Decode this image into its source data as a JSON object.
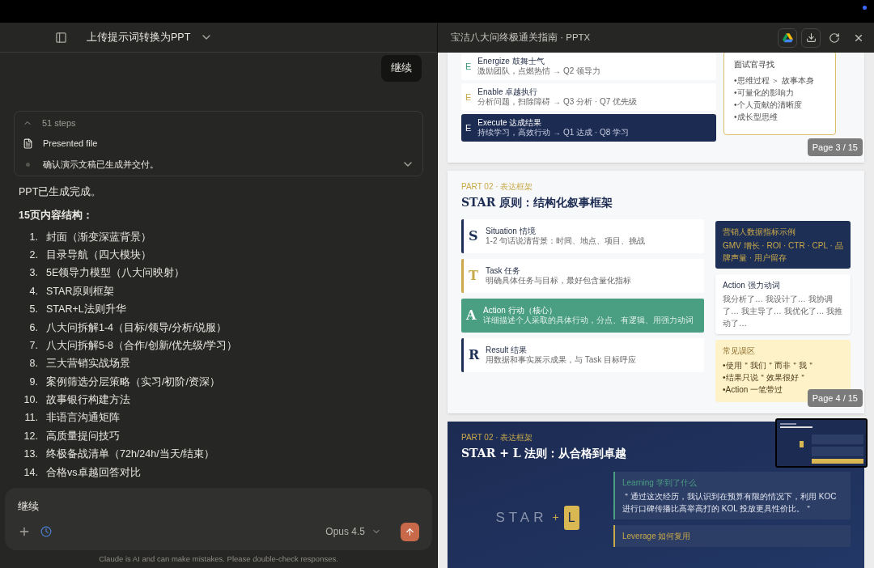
{
  "chat": {
    "title": "上传提示词转换为PPT",
    "user_message": "继续",
    "steps": {
      "count": "51 steps",
      "expanded": true,
      "items": [
        {
          "kind": "file",
          "label": "Presented file"
        },
        {
          "kind": "dot",
          "label": "确认演示文稿已生成并交付。"
        }
      ]
    },
    "reply": {
      "intro": "PPT已生成完成。",
      "heading": "15页内容结构：",
      "list": [
        {
          "num": "1.",
          "text": "封面（渐变深蓝背景）"
        },
        {
          "num": "2.",
          "text": "目录导航（四大模块）"
        },
        {
          "num": "3.",
          "text": "5E领导力模型（八大问映射）"
        },
        {
          "num": "4.",
          "text": "STAR原则框架"
        },
        {
          "num": "5.",
          "text": "STAR+L法则升华"
        },
        {
          "num": "6.",
          "text": "八大问拆解1-4（目标/领导/分析/说服）"
        },
        {
          "num": "7.",
          "text": "八大问拆解5-8（合作/创新/优先级/学习）"
        },
        {
          "num": "8.",
          "text": "三大营销实战场景"
        },
        {
          "num": "9.",
          "text": "案例筛选分层策略（实习/初阶/资深）"
        },
        {
          "num": "10.",
          "text": "故事银行构建方法"
        },
        {
          "num": "11.",
          "text": "非语言沟通矩阵"
        },
        {
          "num": "12.",
          "text": "高质量提问技巧"
        },
        {
          "num": "13.",
          "text": "终极备战清单（72h/24h/当天/结束）"
        },
        {
          "num": "14.",
          "text": "合格vs卓越回答对比"
        }
      ]
    },
    "input": {
      "value": "继续",
      "model": "Opus 4.5",
      "timer_active": true
    },
    "disclaimer": "Claude is AI and can make mistakes. Please double-check responses."
  },
  "preview": {
    "title": "宝洁八大问终极通关指南 · PPTX",
    "slides": [
      {
        "kind": "e_model",
        "page": "Page 3 / 15",
        "items": [
          {
            "letter": "E",
            "title": "Energize  鼓舞士气",
            "desc": "激励团队，点燃热情 → Q2 领导力",
            "color": "#3a9a7a",
            "highlighted": false
          },
          {
            "letter": "E",
            "title": "Enable  卓越执行",
            "desc": "分析问题，扫除障碍 → Q3 分析 · Q7 优先级",
            "color": "#c9a94a",
            "highlighted": false
          },
          {
            "letter": "E",
            "title": "Execute  达成结果",
            "desc": "持续学习，高效行动 → Q1 达成 · Q8 学习",
            "color": "#ffffff",
            "highlighted": true
          }
        ],
        "side": {
          "heading": "面试官寻找",
          "bullets": [
            "•思维过程 ＞ 故事本身",
            "•可量化的影响力",
            "•个人贡献的清晰度",
            "•成长型思维"
          ]
        }
      },
      {
        "kind": "star",
        "page": "Page 4 / 15",
        "part": "PART 02 · 表达框架",
        "title": "STAR 原则：结构化叙事框架",
        "items": [
          {
            "letter": "S",
            "title": "Situation  情境",
            "desc": "1-2 句话说清背景：时间、地点、项目、挑战",
            "color": "#1e2f55",
            "filled": false
          },
          {
            "letter": "T",
            "title": "Task  任务",
            "desc": "明确具体任务与目标，最好包含量化指标",
            "color": "#c9a94a",
            "filled": false
          },
          {
            "letter": "A",
            "title": "Action  行动（核心）",
            "desc": "详细描述个人采取的具体行动，分点、有逻辑、用强力动词",
            "color": "#4a9e82",
            "filled": true
          },
          {
            "letter": "R",
            "title": "Result  结果",
            "desc": "用数据和事实展示成果，与 Task 目标呼应",
            "color": "#1e2f55",
            "filled": false
          }
        ],
        "cards": [
          {
            "kind": "dark",
            "heading": "营销人数据指标示例",
            "body": "GMV 增长 · ROI · CTR · CPL · 品牌声量 · 用户留存"
          },
          {
            "kind": "white",
            "heading": "Action 强力动词",
            "body": "我分析了… 我设计了… 我协调了… 我主导了… 我优化了… 我推动了…"
          },
          {
            "kind": "yellow",
            "heading": "常见误区",
            "bullets": [
              "•使用＂我们＂而非＂我＂",
              "•结果只说＂效果很好＂",
              "•Action 一笔带过"
            ]
          }
        ]
      },
      {
        "kind": "star_l",
        "part": "PART 02 · 表达框架",
        "title": "STAR + L  法则：从合格到卓越",
        "graphic": {
          "word": "STAR",
          "plus": "+",
          "key": "L"
        },
        "cards": [
          {
            "title": "Learning  学到了什么",
            "quote": "＂通过这次经历，我认识到在预算有限的情况下，利用 KOC 进行口碑传播比高举高打的 KOL 投放更具性价比。＂",
            "color": "#4a9e82"
          },
          {
            "title": "Leverage  如何复用",
            "color": "#c9a94a"
          }
        ]
      }
    ]
  }
}
